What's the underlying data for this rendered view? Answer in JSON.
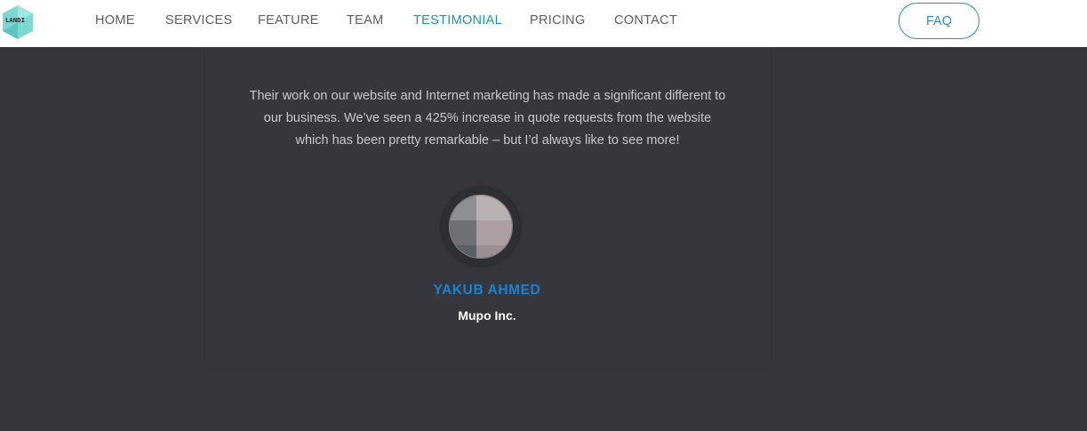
{
  "logo": {
    "text": "LANDI"
  },
  "nav": {
    "items": [
      {
        "label": "HOME",
        "active": false
      },
      {
        "label": "SERVICES",
        "active": false
      },
      {
        "label": "FEATURE",
        "active": false
      },
      {
        "label": "TEAM",
        "active": false
      },
      {
        "label": "TESTIMONIAL",
        "active": true
      },
      {
        "label": "PRICING",
        "active": false
      },
      {
        "label": "CONTACT",
        "active": false
      }
    ],
    "faq_label": "FAQ"
  },
  "testimonial": {
    "quote": "Their work on our website and Internet marketing has made a significant different to our business. We’ve seen a 425% increase in quote requests from the website which has been pretty remarkable – but I’d always like to see more!",
    "name": "YAKUB AHMED",
    "company": "Mupo Inc."
  },
  "colors": {
    "accent": "#1b8fc9",
    "name": "#1a82cf",
    "background": "#35363b",
    "navbar": "#ffffff"
  }
}
